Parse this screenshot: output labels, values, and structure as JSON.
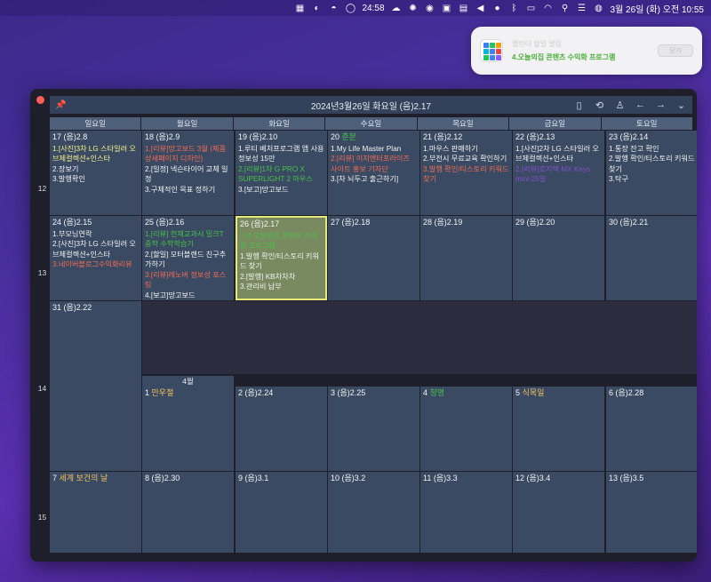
{
  "menubar": {
    "timer": "24:58",
    "datetime": "3월 26일 (화) 오전 10:55"
  },
  "notification": {
    "title": "캘린더 할일 알림",
    "message": "4.오늘의집 콘텐츠 수익화 프로그램",
    "button": "닫기"
  },
  "window": {
    "title": "2024년3월26일 화요일 (음)2.17"
  },
  "weekdays": [
    "일요일",
    "월요일",
    "화요일",
    "수요일",
    "목요일",
    "금요일",
    "토요일"
  ],
  "weeks": [
    "12",
    "13",
    "14",
    "15"
  ],
  "month_label": "4월",
  "cells": [
    {
      "date": "17 (음)2.8",
      "lines": [
        {
          "t": "1.[사진]3차 LG 스타일러 오브제컬렉션+인스타",
          "c": "y"
        },
        {
          "t": "2.장보기",
          "c": "w"
        },
        {
          "t": "3.발행확인",
          "c": "w"
        }
      ]
    },
    {
      "date": "18 (음)2.9",
      "lines": [
        {
          "t": "1.[리뷰]망고보드 3월 (제품상세페이지 디자인)",
          "c": "r"
        },
        {
          "t": "2.[일정] 넥슨타이어 교체 일정",
          "c": "w"
        },
        {
          "t": "3.구체적인 목표 정하기",
          "c": "w"
        }
      ]
    },
    {
      "date": "19 (음)2.10",
      "lines": [
        {
          "t": "1.루티 베처프로그램 앱 사용 정보성 15만",
          "c": "w"
        },
        {
          "t": "2.[리뷰]1차 G PRO X SUPERLIGHT 2 마우스",
          "c": "g"
        },
        {
          "t": "3.[보고]망고보드",
          "c": "w"
        }
      ]
    },
    {
      "date": "20 춘분",
      "lines": [
        {
          "t": "1.My Life Master Plan",
          "c": "w"
        },
        {
          "t": "2.[리뷰] 이지앤터프라이즈 사이트 홍보 기자단",
          "c": "r"
        },
        {
          "t": "3.[차 뇌두고 출근하기]",
          "c": "w"
        }
      ]
    },
    {
      "date": "21 (음)2.12",
      "lines": [
        {
          "t": "1.마우스 판매하기",
          "c": "w"
        },
        {
          "t": "2.부천시 무료교육 확인하기",
          "c": "w"
        },
        {
          "t": "3.발행 확인/티스토리 키워드 찾기",
          "c": "r"
        }
      ]
    },
    {
      "date": "22 (음)2.13",
      "lines": [
        {
          "t": "1.[사진]2차 LG 스타일러 오브제컬렉션+인스타",
          "c": "w"
        },
        {
          "t": "2.[리뷰]로지텍 MX Keys mini-25일",
          "c": "p"
        }
      ]
    },
    {
      "date": "23 (음)2.14",
      "lines": [
        {
          "t": "1.통장 잔고 확인",
          "c": "w"
        },
        {
          "t": "2.발행 확인/티스토리 키워드 찾기",
          "c": "w"
        },
        {
          "t": "3.탁구",
          "c": "w"
        }
      ]
    },
    {
      "date": "24 (음)2.15",
      "lines": [
        {
          "t": "1.부모님연락",
          "c": "w"
        },
        {
          "t": "2.[사진]3차 LG 스타일러 오브제컬렉션+인스타",
          "c": "w"
        },
        {
          "t": "3.네이버블로그수익화리뷰",
          "c": "r"
        }
      ]
    },
    {
      "date": "25 (음)2.16",
      "lines": [
        {
          "t": "1.[리뷰] 천재교과서 밀크T 중학 수학학습기",
          "c": "g"
        },
        {
          "t": "2.[할일] 모터블랜드 친구추가하기",
          "c": "w"
        },
        {
          "t": "3.[리뷰]레노버 정보성 포스팅",
          "c": "r"
        },
        {
          "t": "4.[보고]망고보드",
          "c": "w"
        }
      ]
    },
    {
      "date": "26 (음)2.17",
      "lines": [
        {
          "t": "①4.오늘의집 콘텐츠 수익화 프로그램",
          "c": "g"
        },
        {
          "t": "1.발행 확인/티스토리 키워드 찾기",
          "c": "w"
        },
        {
          "t": "2.[발행] KB차차차",
          "c": "w"
        },
        {
          "t": "3.관리비 납부",
          "c": "w"
        }
      ]
    },
    {
      "date": "27 (음)2.18",
      "lines": []
    },
    {
      "date": "28 (음)2.19",
      "lines": []
    },
    {
      "date": "29 (음)2.20",
      "lines": []
    },
    {
      "date": "30 (음)2.21",
      "lines": []
    },
    {
      "date": "31 (음)2.22",
      "lines": []
    },
    {
      "date": "1 만우절",
      "lines": []
    },
    {
      "date": "2 (음)2.24",
      "lines": []
    },
    {
      "date": "3 (음)2.25",
      "lines": []
    },
    {
      "date": "4 청명",
      "lines": []
    },
    {
      "date": "5 식목일",
      "lines": []
    },
    {
      "date": "6 (음)2.28",
      "lines": []
    },
    {
      "date": "7 세계 보건의 날",
      "lines": []
    },
    {
      "date": "8 (음)2.30",
      "lines": []
    },
    {
      "date": "9 (음)3.1",
      "lines": []
    },
    {
      "date": "10 (음)3.2",
      "lines": []
    },
    {
      "date": "11 (음)3.3",
      "lines": []
    },
    {
      "date": "12 (음)3.4",
      "lines": []
    },
    {
      "date": "13 (음)3.5",
      "lines": []
    }
  ],
  "colors": {
    "cell": "#3a4a62",
    "today": "#7a8a60",
    "today_border": "#e6e87a",
    "red_text": "#f06b55",
    "green_text": "#48c04a",
    "yellow_text": "#f4f08a",
    "purple_text": "#8050c8"
  }
}
